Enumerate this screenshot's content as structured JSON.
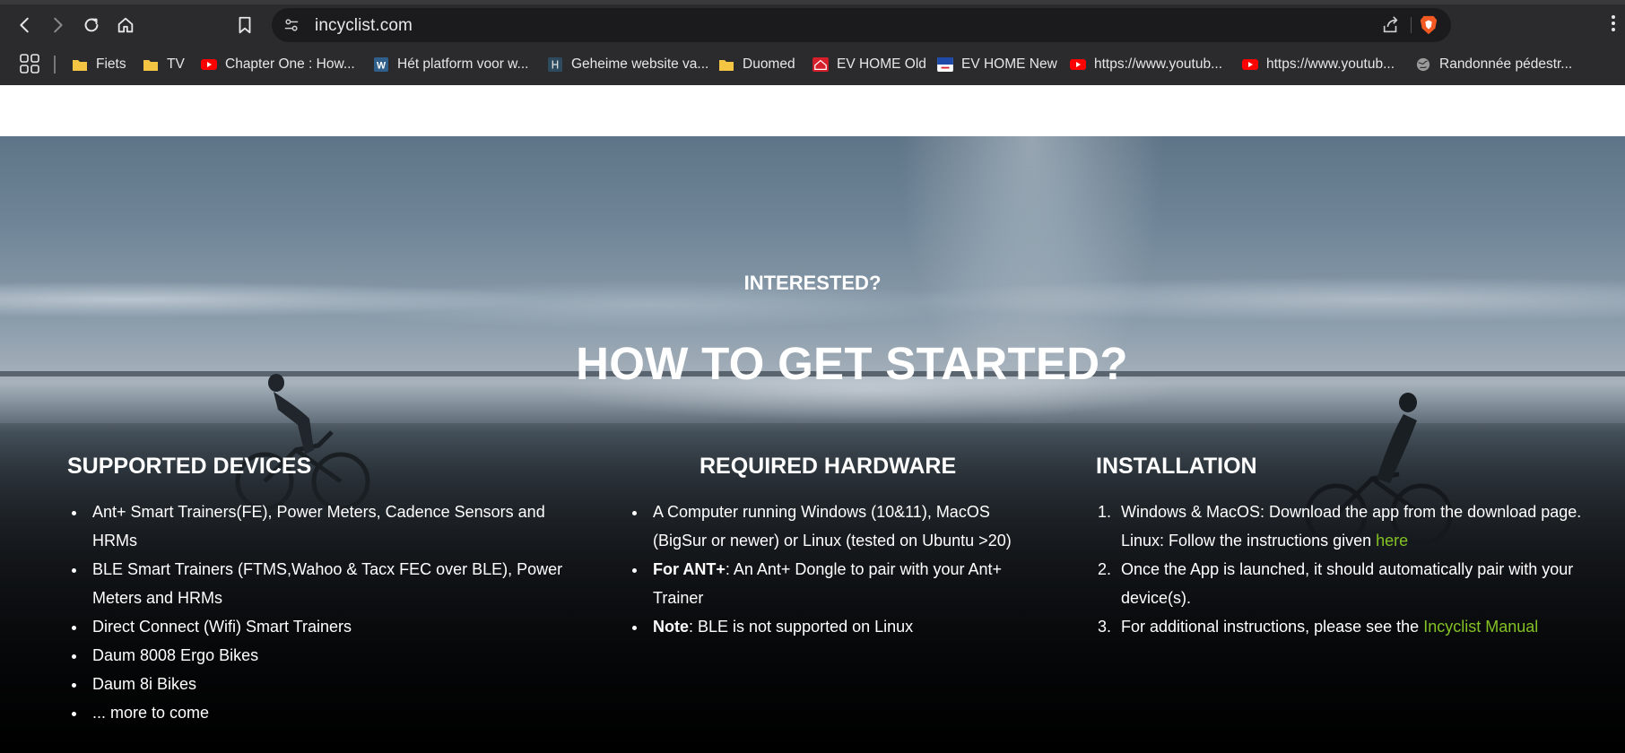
{
  "browser": {
    "url": "incyclist.com",
    "bookmarks": [
      {
        "label": "Fiets",
        "icon": "folder-icon"
      },
      {
        "label": "TV",
        "icon": "folder-icon"
      },
      {
        "label": "Chapter One : How...",
        "icon": "youtube-icon"
      },
      {
        "label": "Hét platform voor w...",
        "icon": "w-site-icon"
      },
      {
        "label": "Geheime website va...",
        "icon": "site-icon"
      },
      {
        "label": "Duomed",
        "icon": "folder-icon"
      },
      {
        "label": "EV HOME Old",
        "icon": "ev-home-icon"
      },
      {
        "label": "EV HOME New",
        "icon": "ev-home-new-icon"
      },
      {
        "label": "https://www.youtub...",
        "icon": "youtube-icon"
      },
      {
        "label": "https://www.youtub...",
        "icon": "youtube-icon"
      },
      {
        "label": "Randonnée pédestr...",
        "icon": "globe-icon"
      }
    ]
  },
  "hero": {
    "eyebrow": "INTERESTED?",
    "headline": "HOW TO GET STARTED?"
  },
  "supported": {
    "title": "SUPPORTED DEVICES",
    "items": [
      "Ant+ Smart Trainers(FE), Power Meters, Cadence Sensors and HRMs",
      "BLE Smart Trainers (FTMS,Wahoo & Tacx FEC over BLE), Power Meters and HRMs",
      "Direct Connect (Wifi) Smart Trainers",
      "Daum 8008 Ergo Bikes",
      "Daum 8i Bikes",
      "... more to come"
    ]
  },
  "hardware": {
    "title": "REQUIRED HARDWARE",
    "item1": "A Computer running Windows (10&11), MacOS (BigSur or newer) or Linux (tested on Ubuntu >20)",
    "item2_bold": "For ANT+",
    "item2_rest": ": An Ant+ Dongle to pair with your Ant+ Trainer",
    "item3_bold": "Note",
    "item3_rest": ": BLE is not supported on Linux"
  },
  "installation": {
    "title": "INSTALLATION",
    "step1_line1": "Windows & MacOS: Download the app from the download page.",
    "step1_line2": "Linux: Follow the instructions given ",
    "step1_link": "here",
    "step2": "Once the App is launched, it should automatically pair with your device(s).",
    "step3_text": "For additional instructions, please see the ",
    "step3_link": "Incyclist Manual"
  },
  "colors": {
    "link": "#84c225",
    "chrome": "#2b2b2d",
    "urlbar": "#1b1b1d"
  }
}
